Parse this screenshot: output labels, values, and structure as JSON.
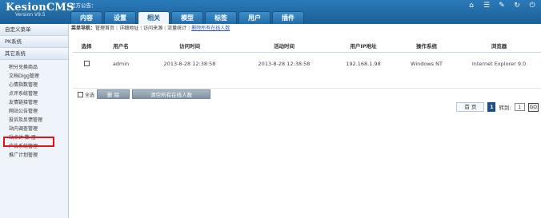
{
  "header": {
    "logo_title": "KesionCMS",
    "logo_version": "Version V9.5",
    "notice_label": "官方公告：",
    "tabs": [
      {
        "label": "内容"
      },
      {
        "label": "设置"
      },
      {
        "label": "相关"
      },
      {
        "label": "模型"
      },
      {
        "label": "标签"
      },
      {
        "label": "用户"
      },
      {
        "label": "插件"
      }
    ],
    "active_tab": "相关",
    "icons": [
      "home-icon",
      "menu-icon",
      "tools-icon",
      "refresh-icon",
      "power-icon"
    ]
  },
  "sidebar": {
    "groups": [
      {
        "label": "自定义菜单"
      },
      {
        "label": "PK系统"
      },
      {
        "label": "其它系统"
      }
    ],
    "items": [
      {
        "label": "积分兑换商品"
      },
      {
        "label": "文档Digg管理"
      },
      {
        "label": "心情指数管理"
      },
      {
        "label": "点评系统管理"
      },
      {
        "label": "友情链接管理"
      },
      {
        "label": "网站公告管理"
      },
      {
        "label": "投诉及反馈管理"
      },
      {
        "label": "站内调查管理"
      },
      {
        "label": "站点计 数 器"
      },
      {
        "label": "广告系统管理"
      },
      {
        "label": "推广计划管理"
      }
    ],
    "highlighted_item": "站点计 数 器"
  },
  "breadcrumb": {
    "prefix": "菜单导航：",
    "links": [
      {
        "label": "管理首页"
      },
      {
        "label": "详细地址"
      },
      {
        "label": "访问来源"
      },
      {
        "label": "流量统计"
      }
    ],
    "active_link": "删除所有在线人数"
  },
  "table": {
    "columns": [
      "选择",
      "用户名",
      "访问时间",
      "活动时间",
      "用户IP地址",
      "操作系统",
      "浏览器"
    ],
    "rows": [
      {
        "username": "admin",
        "visit_time": "2013-8-28 12:38:58",
        "active_time": "2013-8-28 12:38:58",
        "ip": "192.168.1.98",
        "os": "Windows NT",
        "browser": "Internet Explorer 9.0"
      }
    ]
  },
  "actions": {
    "select_all_label": "全选",
    "delete_label": "删 除",
    "clear_all_label": "清空所有在线人数"
  },
  "pager": {
    "first_label": "首 页",
    "current_page": "1",
    "goto_label": "转到:",
    "goto_value": "1",
    "go_label": "GO"
  }
}
